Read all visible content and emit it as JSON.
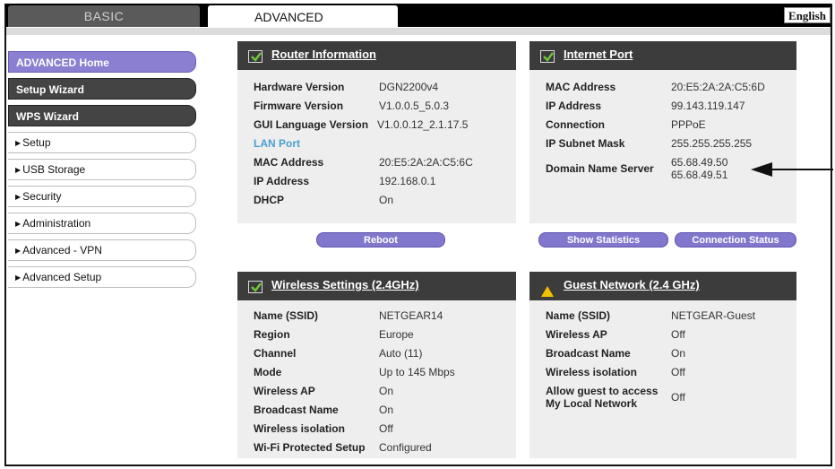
{
  "tabs": {
    "basic": "BASIC",
    "advanced": "ADVANCED"
  },
  "language": "English",
  "sidebar": {
    "buttons": [
      "ADVANCED Home",
      "Setup Wizard",
      "WPS Wizard"
    ],
    "items": [
      "Setup",
      "USB Storage",
      "Security",
      "Administration",
      "Advanced - VPN",
      "Advanced Setup"
    ]
  },
  "router_info": {
    "title": "Router Information",
    "rows": [
      {
        "k": "Hardware Version",
        "v": "DGN2200v4"
      },
      {
        "k": "Firmware Version",
        "v": "V1.0.0.5_5.0.3"
      },
      {
        "k": "GUI Language Version",
        "v": "V1.0.0.12_2.1.17.5"
      }
    ],
    "lan_port": "LAN Port",
    "lan_rows": [
      {
        "k": "MAC Address",
        "v": "20:E5:2A:2A:C5:6C"
      },
      {
        "k": "IP Address",
        "v": "192.168.0.1"
      },
      {
        "k": "DHCP",
        "v": "On"
      }
    ],
    "reboot": "Reboot"
  },
  "internet_port": {
    "title": "Internet Port",
    "rows": [
      {
        "k": "MAC Address",
        "v": "20:E5:2A:2A:C5:6D"
      },
      {
        "k": "IP Address",
        "v": "99.143.119.147"
      },
      {
        "k": "Connection",
        "v": "PPPoE"
      },
      {
        "k": "IP Subnet Mask",
        "v": "255.255.255.255"
      }
    ],
    "dns_label": "Domain Name Server",
    "dns_1": "65.68.49.50",
    "dns_2": "65.68.49.51",
    "show_statistics": "Show Statistics",
    "connection_status": "Connection Status"
  },
  "wireless": {
    "title": "Wireless Settings (2.4GHz)",
    "rows": [
      {
        "k": "Name (SSID)",
        "v": "NETGEAR14"
      },
      {
        "k": "Region",
        "v": "Europe"
      },
      {
        "k": "Channel",
        "v": "Auto (11)"
      },
      {
        "k": "Mode",
        "v": "Up to 145 Mbps"
      },
      {
        "k": "Wireless AP",
        "v": "On"
      },
      {
        "k": "Broadcast Name",
        "v": "On"
      },
      {
        "k": "Wireless isolation",
        "v": "Off"
      },
      {
        "k": "Wi-Fi Protected Setup",
        "v": "Configured"
      }
    ]
  },
  "guest": {
    "title": "Guest Network (2.4 GHz)",
    "rows": [
      {
        "k": "Name (SSID)",
        "v": "NETGEAR-Guest"
      },
      {
        "k": "Wireless AP",
        "v": "Off"
      },
      {
        "k": "Broadcast Name",
        "v": "On"
      },
      {
        "k": "Wireless isolation",
        "v": "Off"
      }
    ],
    "allow_label_1": "Allow guest to access",
    "allow_label_2": "My Local Network",
    "allow_value": "Off"
  },
  "colors": {
    "accent_purple": "#8177cc",
    "panel_header": "#3c3c3c",
    "check_green": "#6cc93a",
    "warn_yellow": "#f2c200"
  }
}
